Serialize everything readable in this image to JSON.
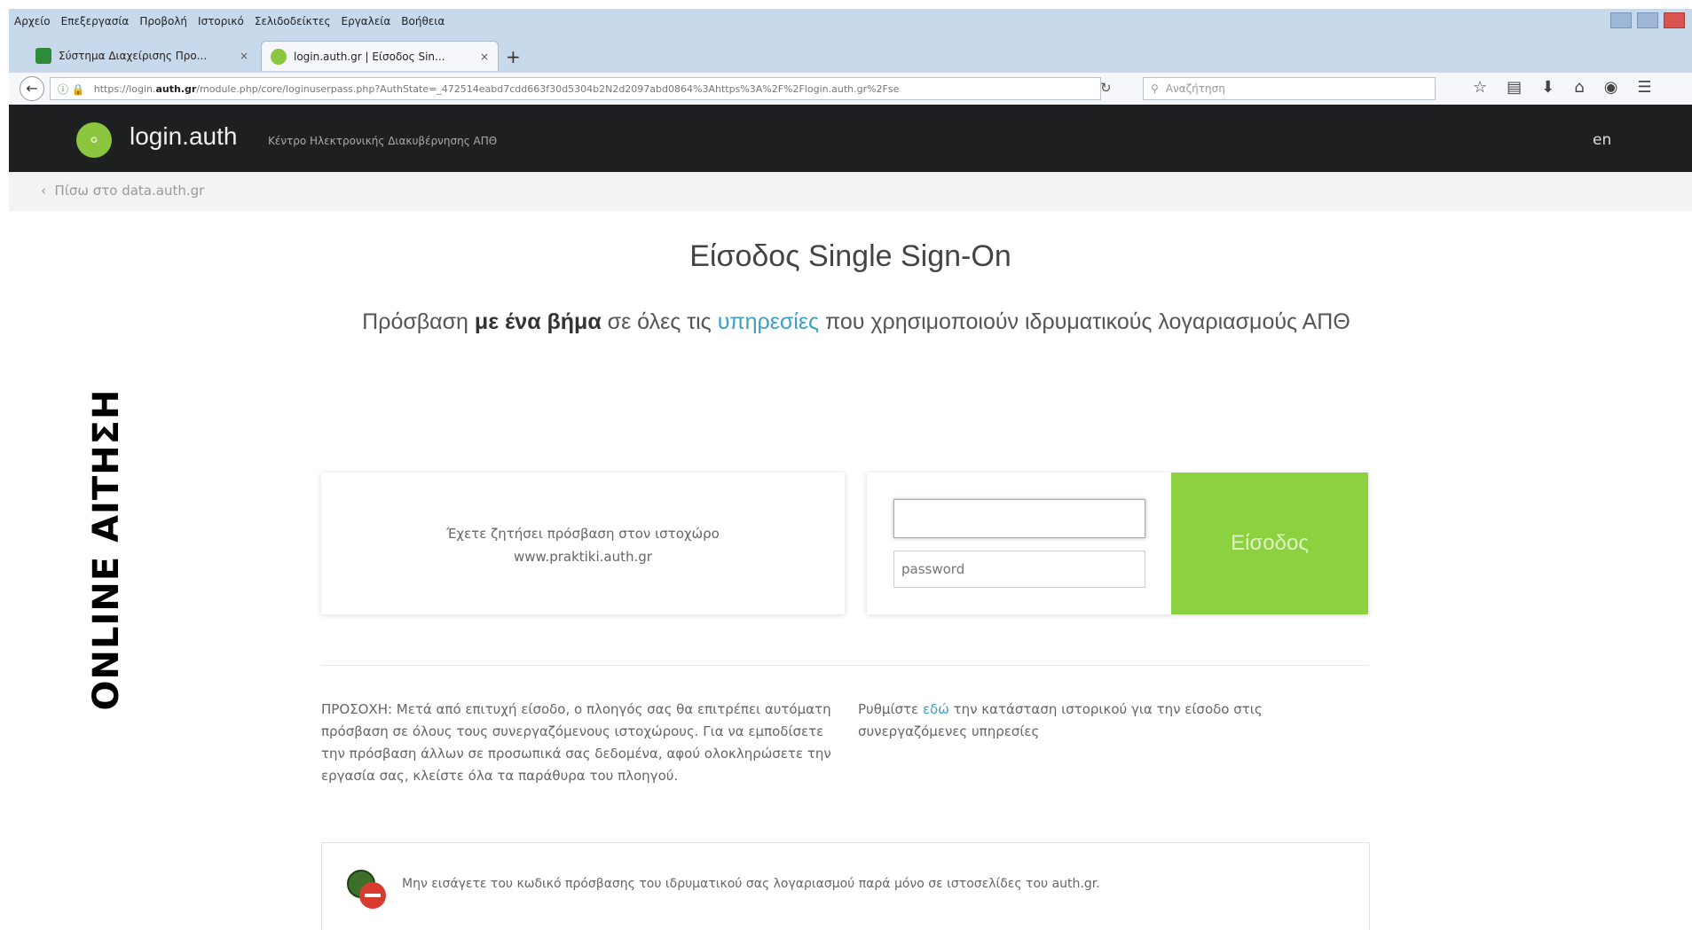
{
  "browser": {
    "menu": [
      "Αρχείο",
      "Επεξεργασία",
      "Προβολή",
      "Ιστορικό",
      "Σελιδοδείκτες",
      "Εργαλεία",
      "Βοήθεια"
    ],
    "tabs": [
      {
        "label": "Σύστημα Διαχείρισης Προ..."
      },
      {
        "label": "login.auth.gr | Είσοδος Sin..."
      }
    ],
    "tab_close": "×",
    "new_tab": "+",
    "url_prefix": "https://login.",
    "url_domain": "auth.gr",
    "url_rest": "/module.php/core/loginuserpass.php?AuthState=_472514eabd7cdd663f30d5304b2N2d2097abd0864%3Ahttps%3A%2F%2Flogin.auth.gr%2Fse",
    "search_placeholder": "Αναζήτηση"
  },
  "header": {
    "brand": "login.auth",
    "subtitle": "Κέντρο Ηλεκτρονικής Διακυβέρνησης ΑΠΘ",
    "lang": "en"
  },
  "breadcrumb": "Πίσω στο data.auth.gr",
  "main": {
    "title": "Είσοδος Single Sign-On",
    "tagline": {
      "p1": "Πρόσβαση ",
      "bold": "με ένα βήμα",
      "p2": " σε όλες τις ",
      "link": "υπηρεσίες",
      "p3": " που χρησιμοποιούν ιδρυματικούς λογαριασμούς ΑΠΘ"
    },
    "request_line1": "Έχετε ζητήσει πρόσβαση στον ιστοχώρο",
    "request_line2": "www.praktiki.auth.gr",
    "username_value": "",
    "password_placeholder": "password",
    "login_button": "Είσοδος",
    "notice": "ΠΡΟΣΟΧΗ: Μετά από επιτυχή είσοδο, ο πλοηγός σας θα επιτρέπει αυτόματη πρόσβαση σε όλους τους συνεργαζόμενους ιστοχώρους. Για να εμποδίσετε την πρόσβαση άλλων σε προσωπικά σας δεδομένα, αφού ολοκληρώσετε την εργασία σας, κλείστε όλα τα παράθυρα του πλοηγού.",
    "history_p1": "Ρυθμίστε ",
    "history_link": "εδώ",
    "history_p2": " την κατάσταση ιστορικού για την είσοδο στις συνεργαζόμενες υπηρεσίες",
    "warning": "Μην εισάγετε του κωδικό πρόσβασης του ιδρυματικού σας λογαριασμού παρά μόνο σε ιστοσελίδες του auth.gr."
  },
  "overlay_label": "ONLINE ΑΙΤΗΣΗ"
}
